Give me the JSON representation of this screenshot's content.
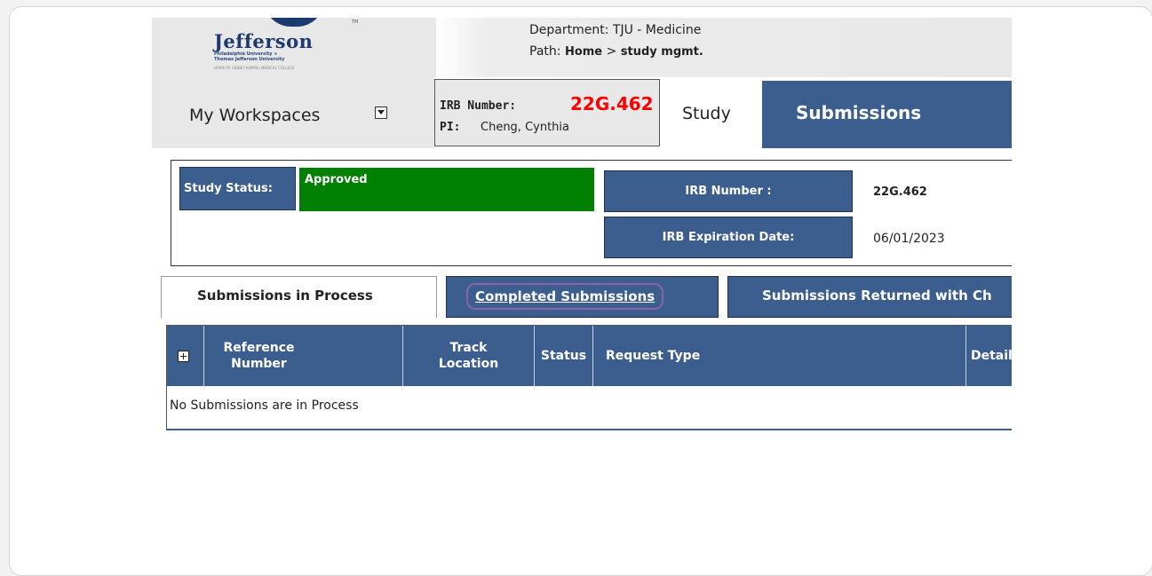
{
  "header": {
    "logo": {
      "name": "Jefferson",
      "tm": "TM",
      "line1": "Philadelphia University +",
      "line2": "Thomas Jefferson University",
      "line3": "HOME OF SIDNEY KIMMEL MEDICAL COLLEGE"
    },
    "department_label": "Department:",
    "department_value": "TJU - Medicine",
    "path_label": "Path:",
    "path_home": "Home",
    "path_sep": ">",
    "path_current": "study mgmt."
  },
  "nav": {
    "workspaces_label": "My Workspaces",
    "irb_label": "IRB Number:",
    "irb_value": "22G.462",
    "pi_label": "PI:",
    "pi_value": "Cheng, Cynthia",
    "study_tab": "Study",
    "submissions_tab": "Submissions"
  },
  "status_panel": {
    "study_status_label": "Study Status:",
    "study_status_value": "Approved",
    "irb_number_label": "IRB Number :",
    "irb_number_value": "22G.462",
    "expiration_label": "IRB Expiration Date:",
    "expiration_value": "06/01/2023"
  },
  "tabs": [
    {
      "label": "Submissions in Process",
      "active": true
    },
    {
      "label": "Completed Submissions",
      "active": false
    },
    {
      "label": "Submissions Returned with Ch",
      "active": false
    }
  ],
  "table": {
    "columns": [
      "Reference Number",
      "Track Location",
      "Status",
      "Request Type",
      "Detail"
    ],
    "col_ref_l1": "Reference",
    "col_ref_l2": "Number",
    "col_track_l1": "Track",
    "col_track_l2": "Location",
    "col_status": "Status",
    "col_request": "Request Type",
    "col_details": "Details",
    "empty_message": "No Submissions are in Process"
  },
  "colors": {
    "primary_blue": "#3c5e8e",
    "approved_green": "#008000",
    "irb_red": "#ff0000",
    "highlight_purple": "#8a63a8"
  }
}
